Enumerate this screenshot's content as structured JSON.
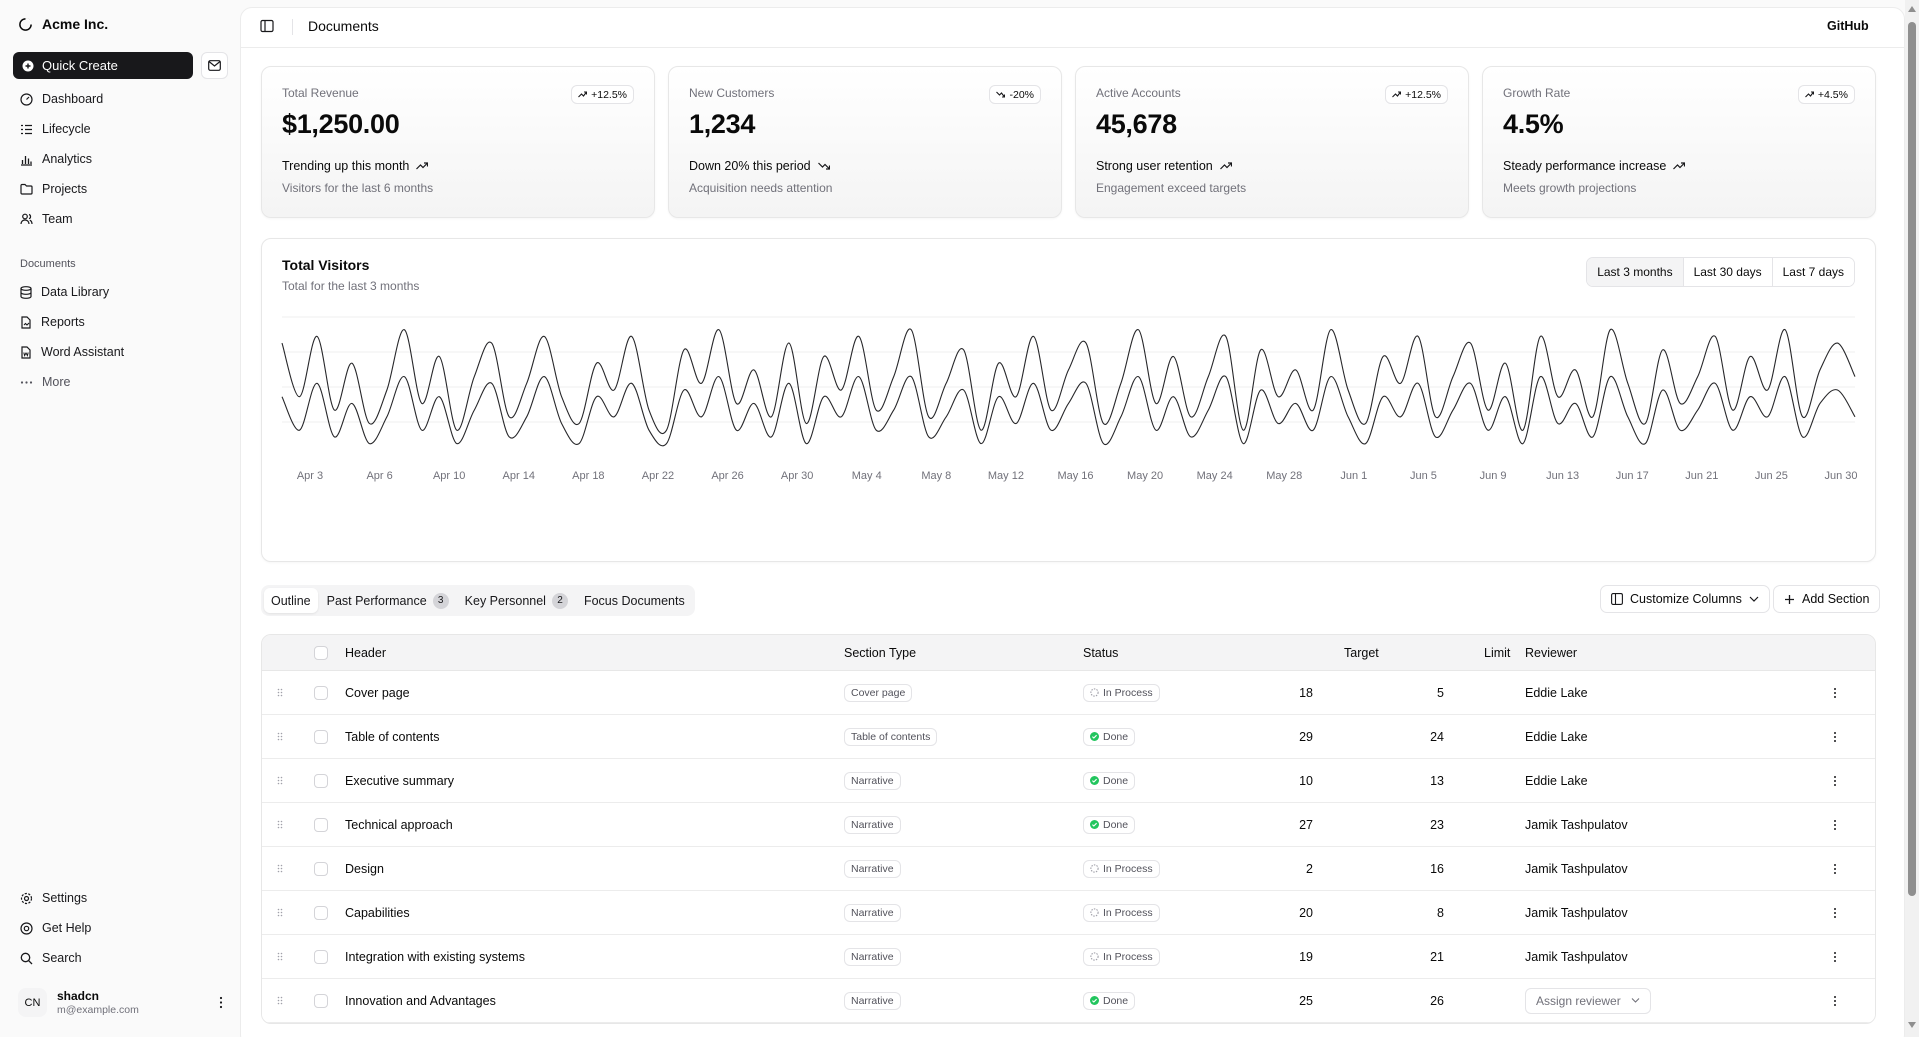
{
  "sidebar": {
    "brand": "Acme Inc.",
    "quick_create": "Quick Create",
    "nav": [
      {
        "label": "Dashboard",
        "icon": "dashboard-icon"
      },
      {
        "label": "Lifecycle",
        "icon": "list-icon"
      },
      {
        "label": "Analytics",
        "icon": "chart-bar-icon"
      },
      {
        "label": "Projects",
        "icon": "folder-icon"
      },
      {
        "label": "Team",
        "icon": "users-icon"
      }
    ],
    "documents_label": "Documents",
    "documents": [
      {
        "label": "Data Library",
        "icon": "database-icon"
      },
      {
        "label": "Reports",
        "icon": "report-icon"
      },
      {
        "label": "Word Assistant",
        "icon": "file-word-icon"
      },
      {
        "label": "More",
        "icon": "dots-horizontal-icon"
      }
    ],
    "secondary": [
      {
        "label": "Settings",
        "icon": "gear-icon"
      },
      {
        "label": "Get Help",
        "icon": "help-icon"
      },
      {
        "label": "Search",
        "icon": "search-icon"
      }
    ],
    "user": {
      "initials": "CN",
      "name": "shadcn",
      "email": "m@example.com"
    }
  },
  "header": {
    "title": "Documents",
    "github": "GitHub"
  },
  "cards": [
    {
      "label": "Total Revenue",
      "badge": "+12.5%",
      "badge_dir": "up",
      "value": "$1,250.00",
      "trend": "Trending up this month",
      "trend_dir": "up",
      "footer": "Visitors for the last 6 months"
    },
    {
      "label": "New Customers",
      "badge": "-20%",
      "badge_dir": "down",
      "value": "1,234",
      "trend": "Down 20% this period",
      "trend_dir": "down",
      "footer": "Acquisition needs attention"
    },
    {
      "label": "Active Accounts",
      "badge": "+12.5%",
      "badge_dir": "up",
      "value": "45,678",
      "trend": "Strong user retention",
      "trend_dir": "up",
      "footer": "Engagement exceed targets"
    },
    {
      "label": "Growth Rate",
      "badge": "+4.5%",
      "badge_dir": "up",
      "value": "4.5%",
      "trend": "Steady performance increase",
      "trend_dir": "up",
      "footer": "Meets growth projections"
    }
  ],
  "chart": {
    "title": "Total Visitors",
    "subtitle": "Total for the last 3 months",
    "ranges": [
      "Last 3 months",
      "Last 30 days",
      "Last 7 days"
    ],
    "selected_range": "Last 3 months"
  },
  "chart_data": {
    "type": "area",
    "title": "Total Visitors",
    "subtitle": "Total for the last 3 months",
    "x_tick_labels": [
      "Apr 3",
      "Apr 6",
      "Apr 10",
      "Apr 14",
      "Apr 18",
      "Apr 22",
      "Apr 26",
      "Apr 30",
      "May 4",
      "May 8",
      "May 12",
      "May 16",
      "May 20",
      "May 24",
      "May 28",
      "Jun 1",
      "Jun 5",
      "Jun 9",
      "Jun 13",
      "Jun 17",
      "Jun 21",
      "Jun 25",
      "Jun 30"
    ],
    "x_start": "Apr 1",
    "x_end": "Jun 30",
    "y_axis_shown": false,
    "grid": "horizontal",
    "series": [
      {
        "values": [
          0.85,
          0.45,
          0.9,
          0.35,
          0.7,
          0.25,
          0.5,
          0.95,
          0.4,
          0.75,
          0.2,
          0.6,
          0.85,
          0.3,
          0.55,
          0.9,
          0.45,
          0.25,
          0.7,
          0.5,
          0.9,
          0.35,
          0.2,
          0.8,
          0.55,
          0.95,
          0.4,
          0.65,
          0.3,
          0.85,
          0.25,
          0.75,
          0.5,
          0.9,
          0.35,
          0.6,
          0.95,
          0.3,
          0.55,
          0.8,
          0.2,
          0.7,
          0.45,
          0.9,
          0.35,
          0.65,
          0.85,
          0.25,
          0.55,
          0.95,
          0.4,
          0.75,
          0.3,
          0.6,
          0.9,
          0.2,
          0.8,
          0.45,
          0.65,
          0.35,
          0.95,
          0.5,
          0.25,
          0.75,
          0.55,
          0.9,
          0.3,
          0.6,
          0.85,
          0.35,
          0.7,
          0.2,
          0.9,
          0.45,
          0.65,
          0.3,
          0.95,
          0.55,
          0.25,
          0.8,
          0.4,
          0.6,
          0.9,
          0.35,
          0.75,
          0.5,
          0.95,
          0.3,
          0.65,
          0.85,
          0.6
        ]
      },
      {
        "values": [
          0.45,
          0.2,
          0.55,
          0.15,
          0.4,
          0.1,
          0.3,
          0.6,
          0.2,
          0.45,
          0.1,
          0.35,
          0.55,
          0.15,
          0.3,
          0.6,
          0.25,
          0.1,
          0.45,
          0.3,
          0.55,
          0.2,
          0.1,
          0.5,
          0.3,
          0.6,
          0.2,
          0.4,
          0.15,
          0.55,
          0.1,
          0.45,
          0.3,
          0.6,
          0.2,
          0.35,
          0.6,
          0.15,
          0.3,
          0.5,
          0.1,
          0.45,
          0.25,
          0.55,
          0.2,
          0.4,
          0.55,
          0.1,
          0.3,
          0.6,
          0.2,
          0.45,
          0.15,
          0.35,
          0.6,
          0.1,
          0.5,
          0.25,
          0.4,
          0.2,
          0.6,
          0.3,
          0.1,
          0.45,
          0.3,
          0.55,
          0.15,
          0.35,
          0.55,
          0.2,
          0.45,
          0.1,
          0.6,
          0.25,
          0.4,
          0.15,
          0.6,
          0.3,
          0.1,
          0.5,
          0.2,
          0.35,
          0.55,
          0.2,
          0.45,
          0.3,
          0.6,
          0.15,
          0.4,
          0.5,
          0.3
        ]
      }
    ]
  },
  "tabs": [
    {
      "label": "Outline",
      "count": null,
      "active": true
    },
    {
      "label": "Past Performance",
      "count": "3",
      "active": false
    },
    {
      "label": "Key Personnel",
      "count": "2",
      "active": false
    },
    {
      "label": "Focus Documents",
      "count": null,
      "active": false
    }
  ],
  "toolbar": {
    "customize": "Customize Columns",
    "add_section": "Add Section"
  },
  "table": {
    "columns": {
      "header": "Header",
      "type": "Section Type",
      "status": "Status",
      "target": "Target",
      "limit": "Limit",
      "reviewer": "Reviewer"
    },
    "rows": [
      {
        "header": "Cover page",
        "type": "Cover page",
        "status": "In Process",
        "status_kind": "process",
        "target": "18",
        "limit": "5",
        "reviewer": "Eddie Lake"
      },
      {
        "header": "Table of contents",
        "type": "Table of contents",
        "status": "Done",
        "status_kind": "done",
        "target": "29",
        "limit": "24",
        "reviewer": "Eddie Lake"
      },
      {
        "header": "Executive summary",
        "type": "Narrative",
        "status": "Done",
        "status_kind": "done",
        "target": "10",
        "limit": "13",
        "reviewer": "Eddie Lake"
      },
      {
        "header": "Technical approach",
        "type": "Narrative",
        "status": "Done",
        "status_kind": "done",
        "target": "27",
        "limit": "23",
        "reviewer": "Jamik Tashpulatov"
      },
      {
        "header": "Design",
        "type": "Narrative",
        "status": "In Process",
        "status_kind": "process",
        "target": "2",
        "limit": "16",
        "reviewer": "Jamik Tashpulatov"
      },
      {
        "header": "Capabilities",
        "type": "Narrative",
        "status": "In Process",
        "status_kind": "process",
        "target": "20",
        "limit": "8",
        "reviewer": "Jamik Tashpulatov"
      },
      {
        "header": "Integration with existing systems",
        "type": "Narrative",
        "status": "In Process",
        "status_kind": "process",
        "target": "19",
        "limit": "21",
        "reviewer": "Jamik Tashpulatov"
      },
      {
        "header": "Innovation and Advantages",
        "type": "Narrative",
        "status": "Done",
        "status_kind": "done",
        "target": "25",
        "limit": "26",
        "reviewer": "",
        "reviewer_placeholder": "Assign reviewer"
      }
    ]
  },
  "colors": {
    "primary": "#18181b",
    "done": "#22c55e",
    "muted": "#71717a",
    "border": "#e4e4e7"
  }
}
